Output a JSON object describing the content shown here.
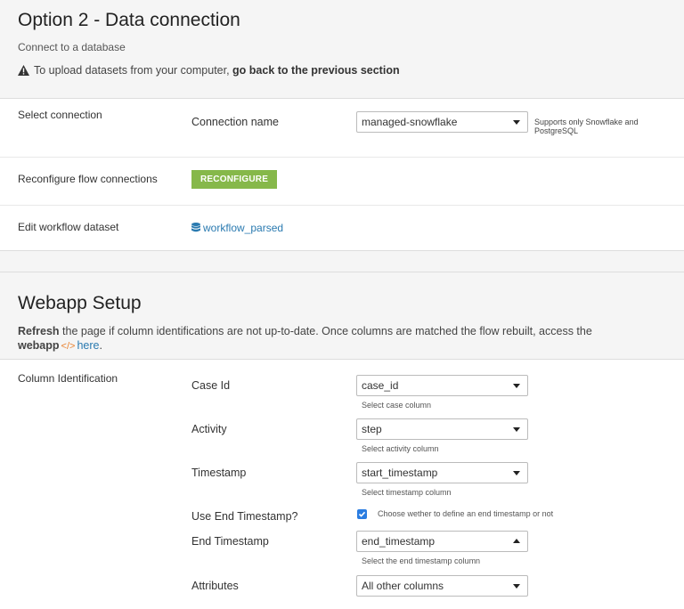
{
  "option2": {
    "title": "Option 2 - Data connection",
    "subtitle": "Connect to a database",
    "warning_text": "To upload datasets from your computer,",
    "warning_bold": "go back to the previous section"
  },
  "connection": {
    "select_connection_label": "Select connection",
    "connection_name_label": "Connection name",
    "connection_name_value": "managed-snowflake",
    "connection_hint": "Supports only Snowflake and PostgreSQL",
    "reconfigure_label": "Reconfigure flow connections",
    "reconfigure_button": "RECONFIGURE",
    "edit_dataset_label": "Edit workflow dataset",
    "dataset_link": "workflow_parsed"
  },
  "webapp": {
    "title": "Webapp Setup",
    "refresh_bold": "Refresh",
    "refresh_text": "the page if column identifications are not up-to-date. Once columns are matched the flow rebuilt, access the",
    "webapp_bold": "webapp",
    "code_glyph": "</>",
    "here_link": "here",
    "period": "."
  },
  "columns": {
    "section_label": "Column Identification",
    "case_id_label": "Case Id",
    "case_id_value": "case_id",
    "case_id_hint": "Select case column",
    "activity_label": "Activity",
    "activity_value": "step",
    "activity_hint": "Select activity column",
    "timestamp_label": "Timestamp",
    "timestamp_value": "start_timestamp",
    "timestamp_hint": "Select timestamp column",
    "use_end_label": "Use End Timestamp?",
    "use_end_checked": true,
    "use_end_hint": "Choose wether to define an end timestamp or not",
    "end_timestamp_label": "End Timestamp",
    "end_timestamp_value": "end_timestamp",
    "end_timestamp_hint": "Select the end timestamp column",
    "attributes_label": "Attributes",
    "attributes_value": "All other columns"
  },
  "colors": {
    "accent_green": "#86b84a",
    "link_blue": "#2a7ab0",
    "checkbox_blue": "#2a7de1",
    "code_orange": "#e9822f"
  }
}
